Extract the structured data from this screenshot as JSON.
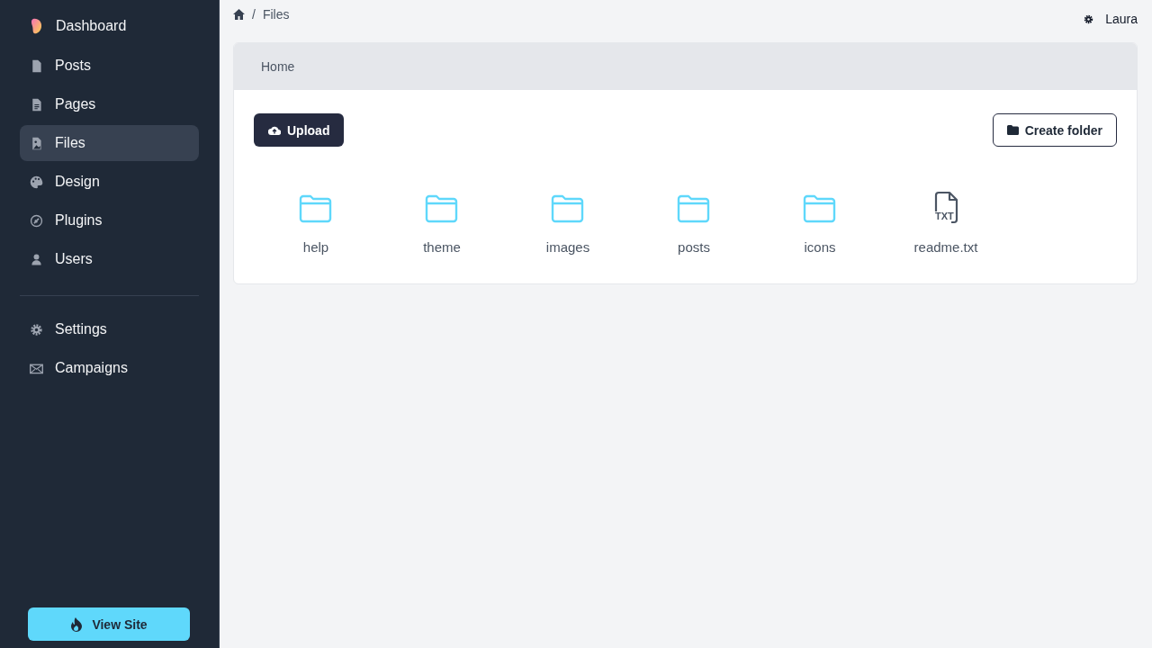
{
  "sidebar": {
    "brand": {
      "label": "Dashboard"
    },
    "items": [
      {
        "label": "Posts",
        "selected": false
      },
      {
        "label": "Pages",
        "selected": false
      },
      {
        "label": "Files",
        "selected": true
      },
      {
        "label": "Design",
        "selected": false
      },
      {
        "label": "Plugins",
        "selected": false
      },
      {
        "label": "Users",
        "selected": false
      }
    ],
    "secondary_items": [
      {
        "label": "Settings",
        "selected": false
      },
      {
        "label": "Campaigns",
        "selected": false
      }
    ],
    "view_site_button": "View Site"
  },
  "breadcrumb": [
    {
      "separator": "/",
      "label": "Files"
    }
  ],
  "user": {
    "name": "Laura"
  },
  "panel": {
    "path": "Home",
    "upload_button": "Upload",
    "create_folder_button": "Create folder",
    "entries": [
      {
        "kind": "folder",
        "name": "help"
      },
      {
        "kind": "folder",
        "name": "theme"
      },
      {
        "kind": "folder",
        "name": "images"
      },
      {
        "kind": "folder",
        "name": "posts"
      },
      {
        "kind": "folder",
        "name": "icons"
      },
      {
        "kind": "file",
        "name": "readme.txt",
        "badge": "TXT"
      }
    ]
  }
}
